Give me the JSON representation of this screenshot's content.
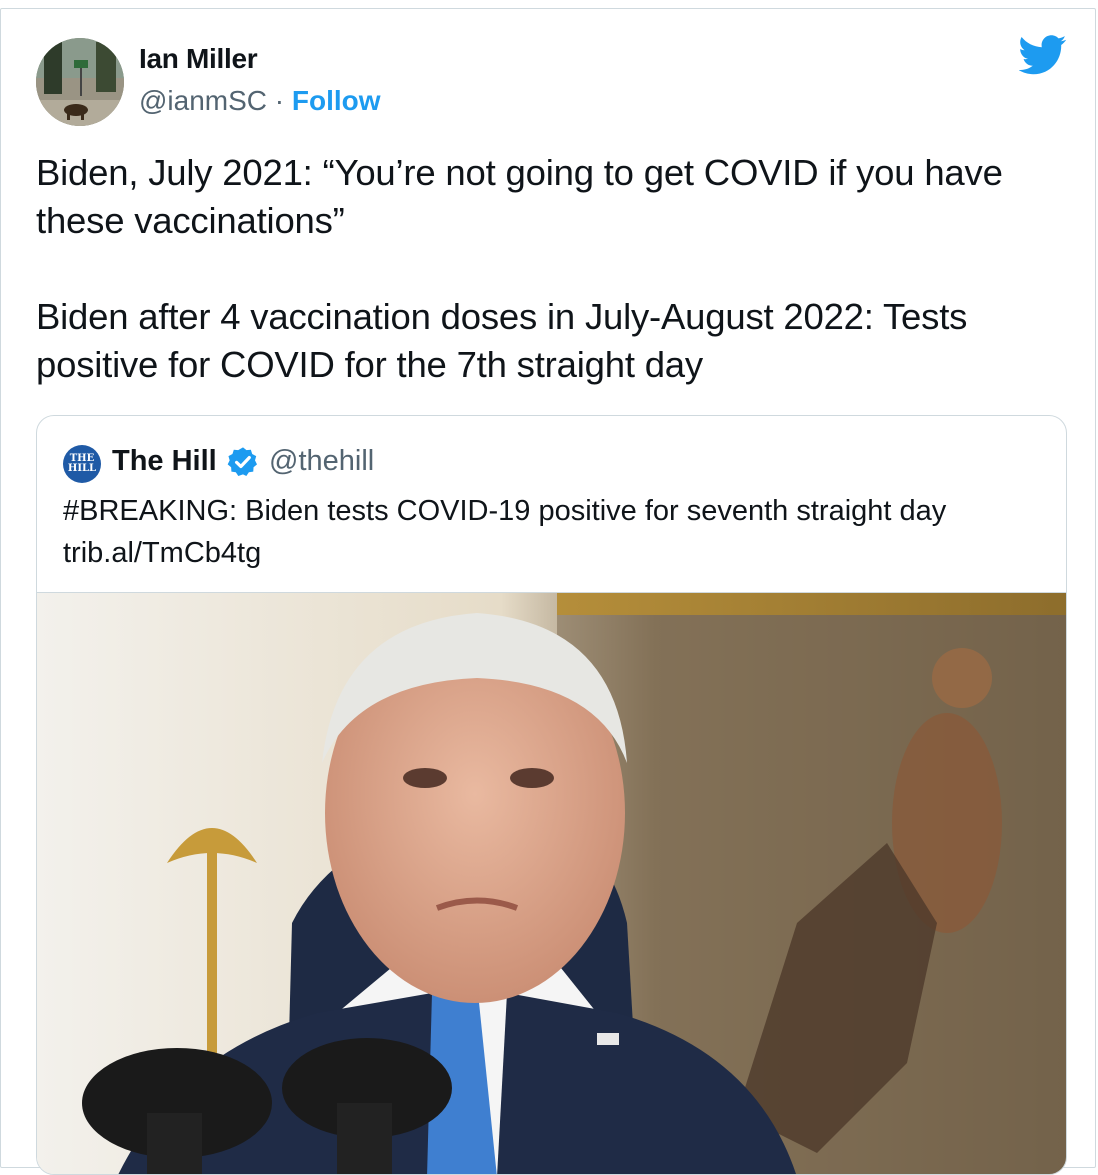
{
  "author": {
    "name": "Ian Miller",
    "handle": "@ianmSC",
    "separator": "·",
    "follow_label": "Follow"
  },
  "icons": {
    "brand": "twitter-bird-icon",
    "verified": "verified-badge-icon"
  },
  "tweet": {
    "text": "Biden, July 2021: “You’re not going to get COVID if you have these vaccinations”\n\nBiden after 4 vaccination doses in July-August 2022: Tests positive for COVID for the 7th straight day"
  },
  "quoted_tweet": {
    "logo_text": "THE HILL",
    "name": "The Hill",
    "handle": "@thehill",
    "text": "#BREAKING: Biden tests COVID-19 positive for seventh straight day\ntrib.al/TmCb4tg"
  },
  "colors": {
    "accent": "#1d9bf0",
    "secondary_text": "#536471",
    "border": "#cfd9de"
  }
}
